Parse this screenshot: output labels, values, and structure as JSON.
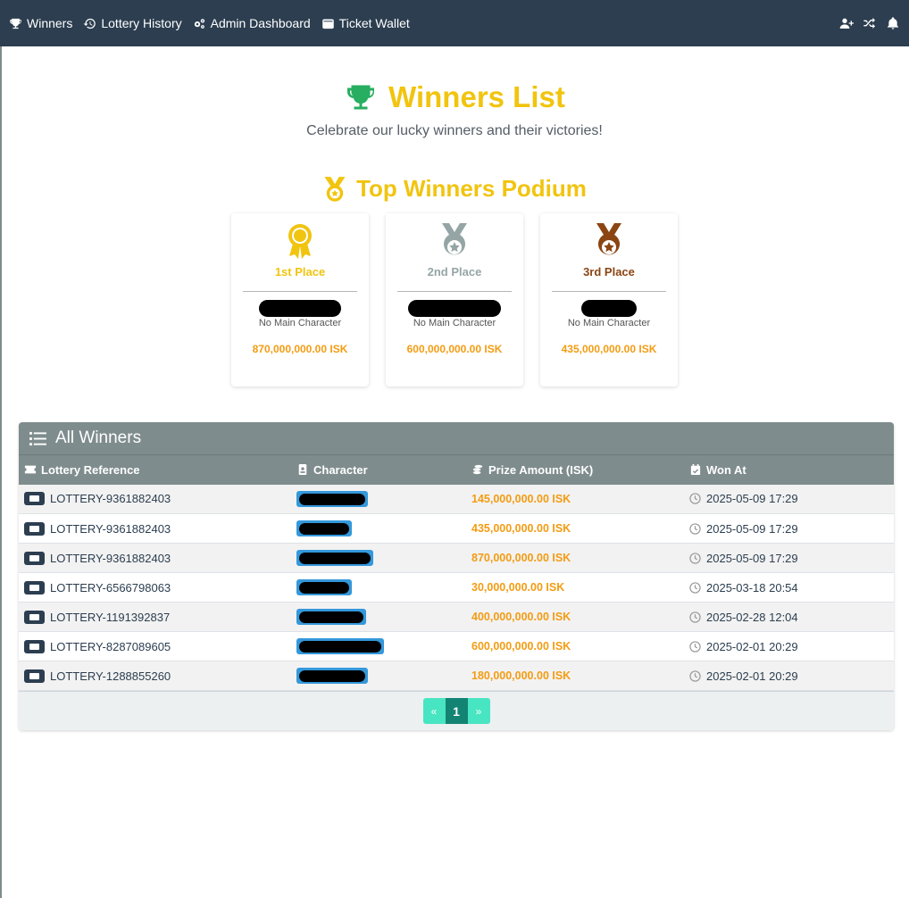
{
  "nav": {
    "items": [
      {
        "label": "Winners",
        "icon": "trophy-icon"
      },
      {
        "label": "Lottery History",
        "icon": "history-icon"
      },
      {
        "label": "Admin Dashboard",
        "icon": "cogs-icon"
      },
      {
        "label": "Ticket Wallet",
        "icon": "wallet-icon"
      }
    ],
    "right_icons": [
      "user-plus-icon",
      "shuffle-icon",
      "bell-icon"
    ]
  },
  "header": {
    "title": "Winners List",
    "subtitle": "Celebrate our lucky winners and their victories!"
  },
  "podium": {
    "title": "Top Winners Podium",
    "cards": [
      {
        "place": "1st Place",
        "character": "No Main Character",
        "prize": "870,000,000.00 ISK",
        "color": "#f1c40f"
      },
      {
        "place": "2nd Place",
        "character": "No Main Character",
        "prize": "600,000,000.00 ISK",
        "color": "#95a5a6"
      },
      {
        "place": "3rd Place",
        "character": "No Main Character",
        "prize": "435,000,000.00 ISK",
        "color": "#8b4513"
      }
    ]
  },
  "table": {
    "title": "All Winners",
    "columns": [
      "Lottery Reference",
      "Character",
      "Prize Amount (ISK)",
      "Won At"
    ],
    "rows": [
      {
        "ref": "LOTTERY-9361882403",
        "amount": "145,000,000.00 ISK",
        "won_at": "2025-05-09 17:29"
      },
      {
        "ref": "LOTTERY-9361882403",
        "amount": "435,000,000.00 ISK",
        "won_at": "2025-05-09 17:29"
      },
      {
        "ref": "LOTTERY-9361882403",
        "amount": "870,000,000.00 ISK",
        "won_at": "2025-05-09 17:29"
      },
      {
        "ref": "LOTTERY-6566798063",
        "amount": "30,000,000.00 ISK",
        "won_at": "2025-03-18 20:54"
      },
      {
        "ref": "LOTTERY-1191392837",
        "amount": "400,000,000.00 ISK",
        "won_at": "2025-02-28 12:04"
      },
      {
        "ref": "LOTTERY-8287089605",
        "amount": "600,000,000.00 ISK",
        "won_at": "2025-02-01 20:29"
      },
      {
        "ref": "LOTTERY-1288855260",
        "amount": "180,000,000.00 ISK",
        "won_at": "2025-02-01 20:29"
      }
    ]
  },
  "pagination": {
    "prev": "«",
    "current": "1",
    "next": "»"
  },
  "colors": {
    "navbar": "#2c3e50",
    "accent": "#f1c40f",
    "prize": "#f39c12",
    "table_header": "#7f8c8d",
    "pager": "#48e5c2",
    "pager_active": "#138474"
  }
}
